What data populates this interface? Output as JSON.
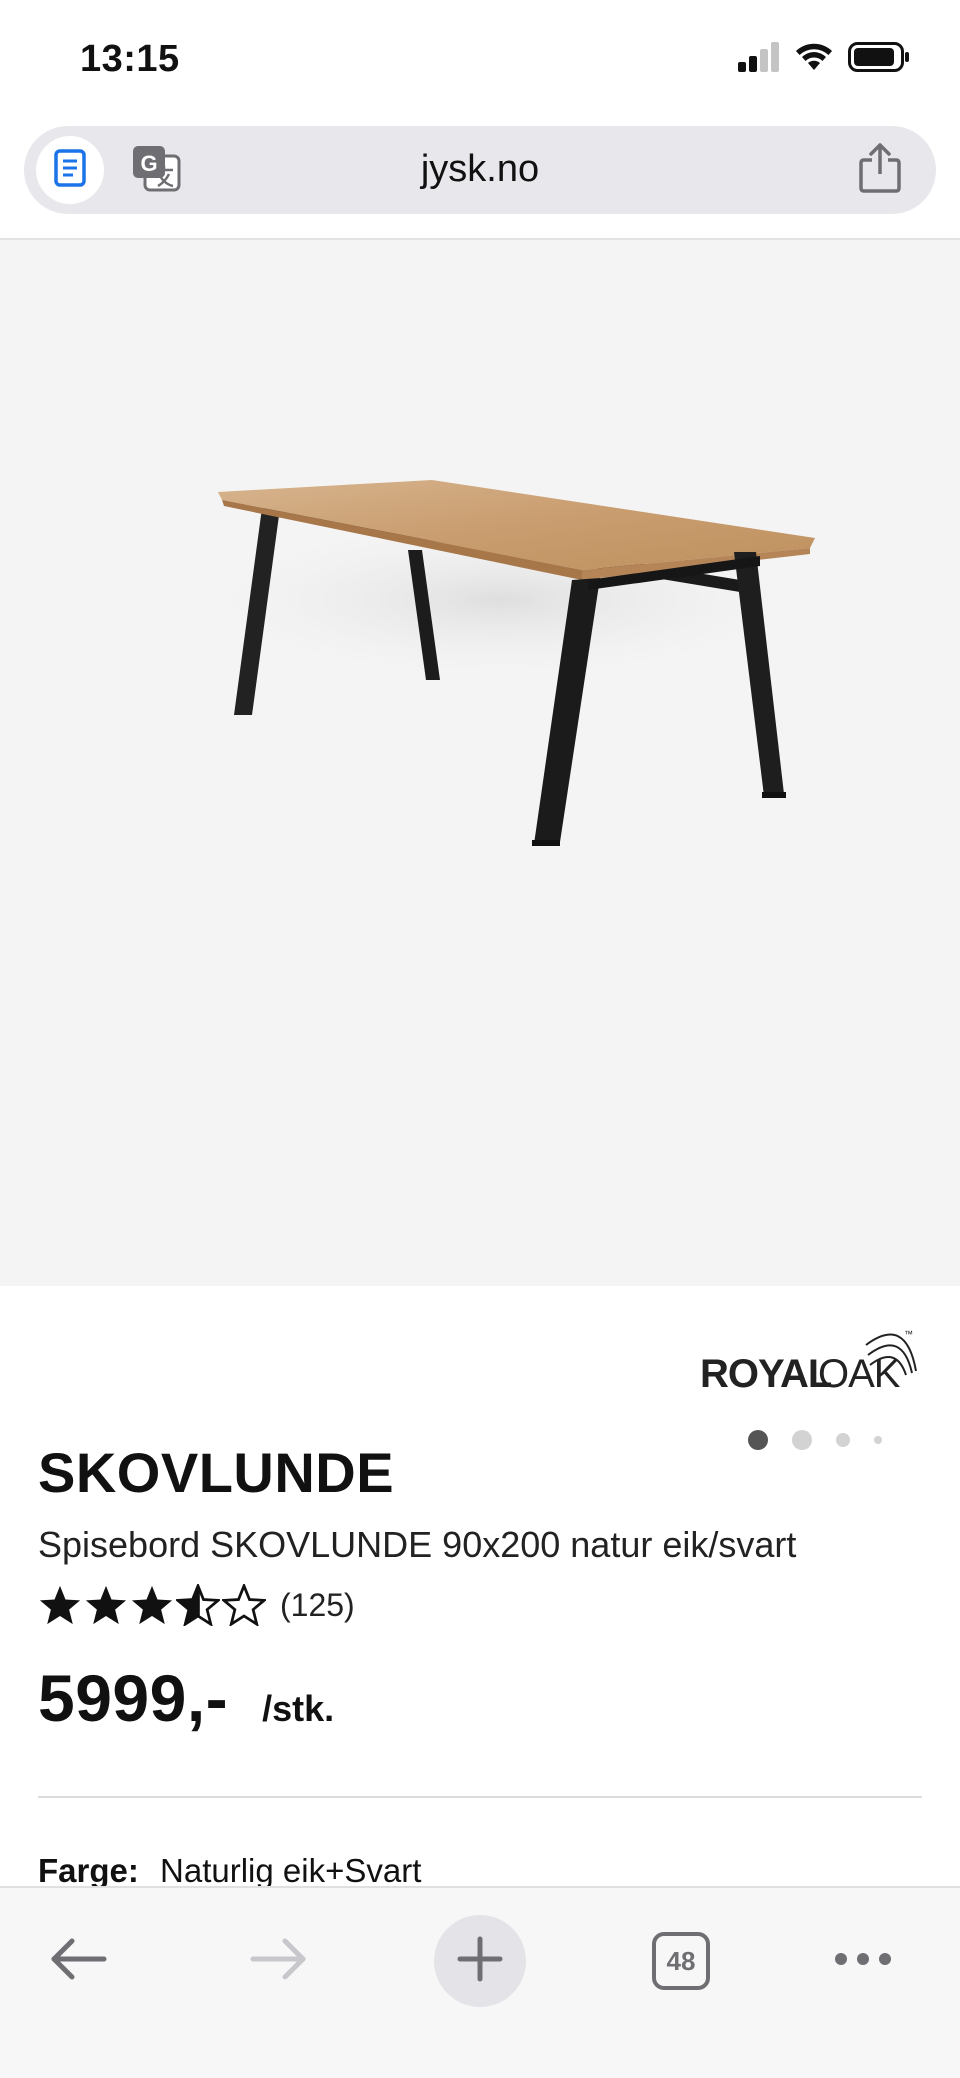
{
  "status_bar": {
    "time": "13:15",
    "icons": [
      "cellular-signal-icon",
      "wifi-icon",
      "battery-icon"
    ]
  },
  "browser": {
    "url": "jysk.no",
    "reader_icon": "reader-mode-icon",
    "translate_icon": "translate-icon",
    "share_icon": "share-icon"
  },
  "gallery": {
    "image_alt": "Spisebord SKOVLUNDE",
    "total_images": 4,
    "current_index": 1
  },
  "product": {
    "brand": "ROYALOAK",
    "brand_trademark": "™",
    "name": "SKOVLUNDE",
    "description": "Spisebord SKOVLUNDE 90x200 natur eik/svart",
    "rating_value": 4.5,
    "rating_max": 5,
    "review_count": "(125)",
    "price": "5999,-",
    "price_unit": "/stk.",
    "color_label": "Farge:",
    "color_value": "Naturlig eik+Svart"
  },
  "toolbar": {
    "back_icon": "back-arrow-icon",
    "forward_icon": "forward-arrow-icon",
    "new_tab_icon": "plus-icon",
    "tab_count": "48",
    "more_icon": "more-icon"
  },
  "colors": {
    "url_bar_bg": "#e8e8ec",
    "image_bg": "#f4f4f4",
    "reader_icon": "#1a73e8",
    "toolbar_icon": "#6e6e73"
  }
}
